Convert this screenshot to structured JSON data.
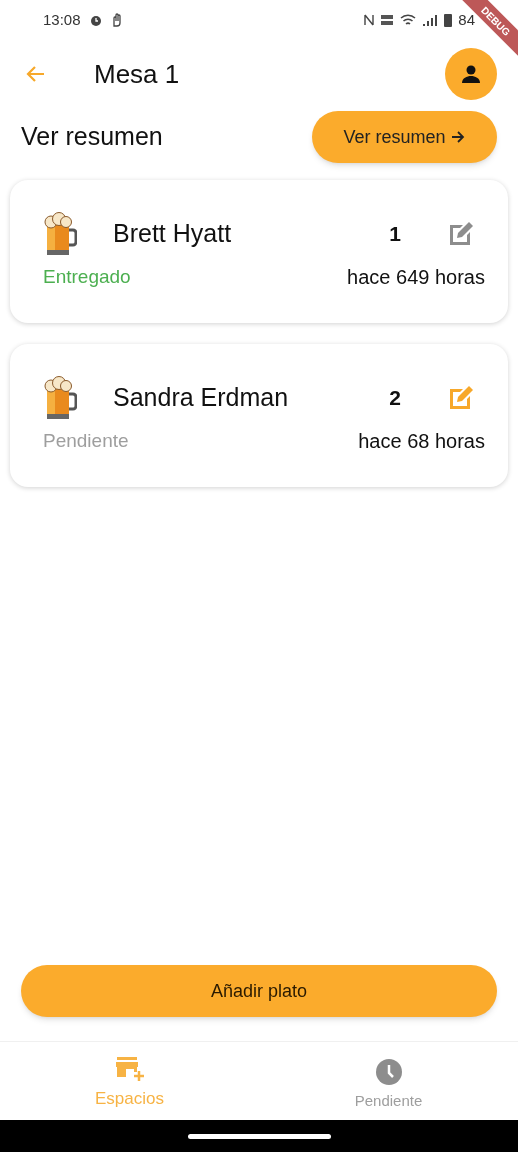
{
  "status_bar": {
    "time": "13:08",
    "battery": "84"
  },
  "debug_banner": "DEBUG",
  "app_bar": {
    "title": "Mesa 1"
  },
  "summary": {
    "label": "Ver resumen",
    "button": "Ver resumen"
  },
  "orders": [
    {
      "name": "Brett Hyatt",
      "count": "1",
      "status": "Entregado",
      "kind": "delivered",
      "time": "hace 649 horas"
    },
    {
      "name": "Sandra Erdman",
      "count": "2",
      "status": "Pendiente",
      "kind": "pending",
      "time": "hace 68 horas"
    }
  ],
  "add_button": "Añadir plato",
  "bottom_nav": [
    {
      "label": "Espacios",
      "kind": "spaces",
      "selected": true
    },
    {
      "label": "Pendiente",
      "kind": "pending",
      "selected": false
    }
  ]
}
